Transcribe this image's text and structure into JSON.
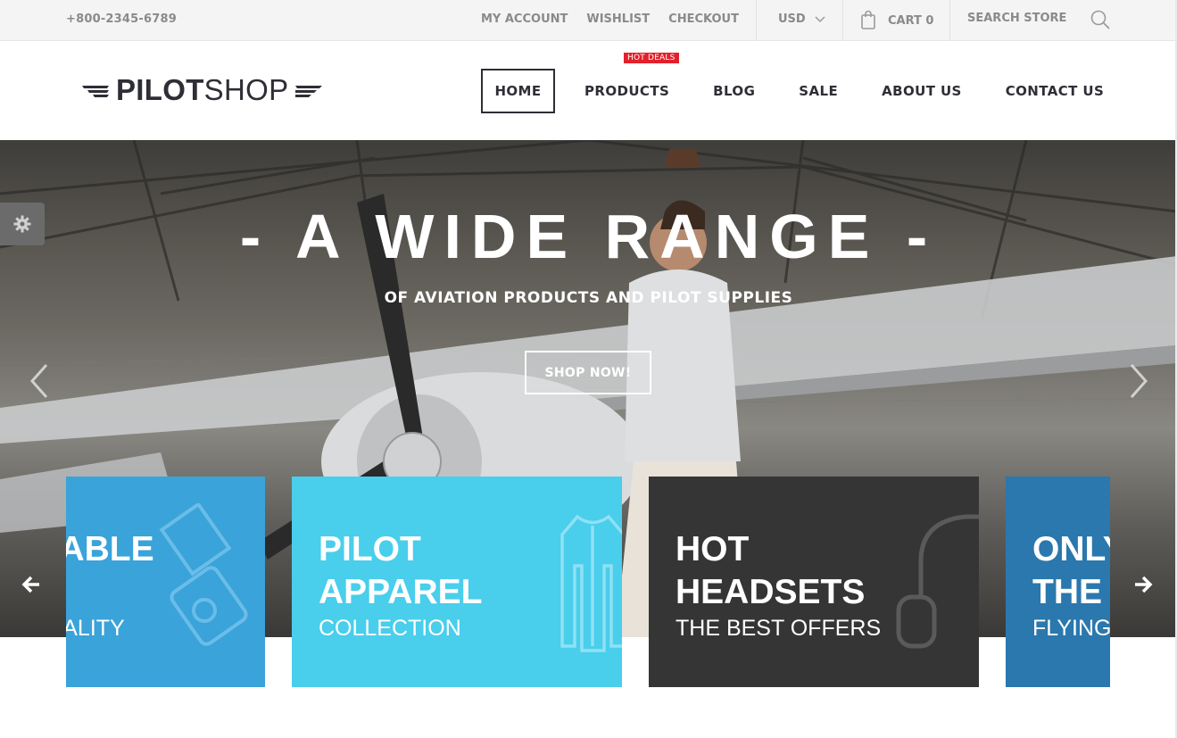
{
  "topbar": {
    "phone": "+800-2345-6789",
    "links": [
      "MY ACCOUNT",
      "WISHLIST",
      "CHECKOUT"
    ],
    "currency": "USD",
    "cart_label": "CART 0",
    "search_placeholder": "SEARCH STORE"
  },
  "header": {
    "logo_bold": "PILOT",
    "logo_light": "SHOP",
    "nav": {
      "home": "HOME",
      "products": "PRODUCTS",
      "products_badge": "HOT DEALS",
      "blog": "BLOG",
      "sale": "SALE",
      "about": "ABOUT US",
      "contact": "CONTACT US"
    }
  },
  "hero": {
    "title": "- A WIDE RANGE -",
    "subtitle": "OF AVIATION PRODUCTS AND PILOT SUPPLIES",
    "button": "SHOP NOW!"
  },
  "banners": [
    {
      "title": "AFFORDABLE",
      "title2": "",
      "subtitle": "THE BEST QUALITY",
      "color": "#3aa3d9",
      "icon": "radio-icon"
    },
    {
      "title": "PILOT",
      "title2": "APPAREL",
      "subtitle": "COLLECTION",
      "color": "#49ceec",
      "icon": "jacket-icon"
    },
    {
      "title": "HOT",
      "title2": "HEADSETS",
      "subtitle": "THE BEST OFFERS",
      "color": "#353535",
      "icon": "headset-icon"
    },
    {
      "title": "ONLY",
      "title2": "THE BEST",
      "subtitle": "FLYING GEAR",
      "color": "#2a78ad",
      "icon": "plane-icon"
    }
  ],
  "colors": {
    "accent_red": "#e3202b",
    "dark_text": "#2e2e36",
    "muted_text": "#8a8a8a"
  }
}
